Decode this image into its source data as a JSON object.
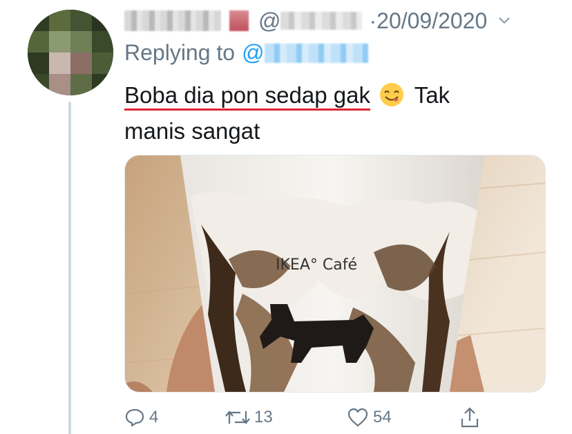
{
  "tweet": {
    "at_sign": "@",
    "date": "·20/09/2020",
    "replying_to_label": "Replying to",
    "mention_at": "@",
    "text_underlined": "Boba dia pon sedap gak",
    "text_rest_1": "Tak",
    "text_rest_2": "manis sangat",
    "emoji": "face-savoring-food-emoji",
    "media": {
      "cup_text": "IKEA° Café"
    }
  },
  "actions": {
    "reply_count": "4",
    "retweet_count": "13",
    "like_count": "54"
  },
  "colors": {
    "secondary_text": "#657786",
    "link": "#1da1f2",
    "thread_line": "#ccd6dd",
    "underline": "#e0242f"
  }
}
